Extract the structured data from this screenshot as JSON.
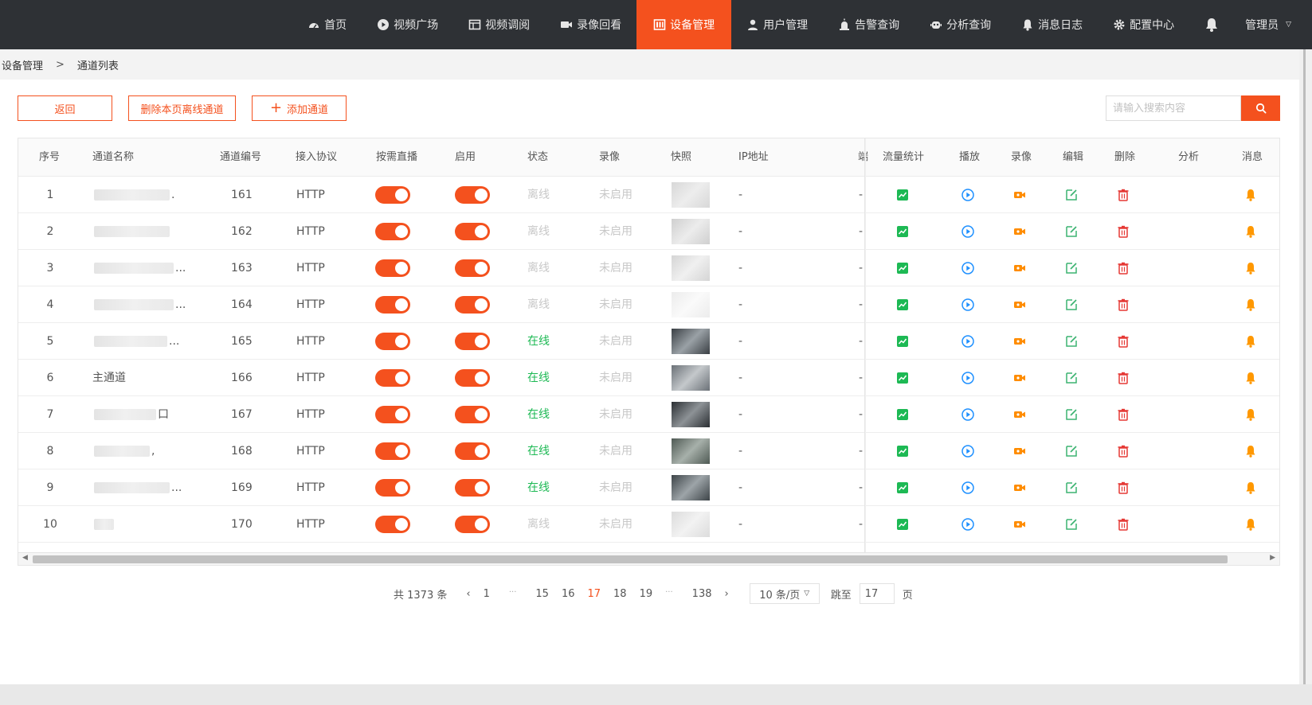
{
  "nav": {
    "items": [
      {
        "label": "首页",
        "icon": "dashboard-icon"
      },
      {
        "label": "视频广场",
        "icon": "play-circle-icon"
      },
      {
        "label": "视频调阅",
        "icon": "grid-icon"
      },
      {
        "label": "录像回看",
        "icon": "video-camera-icon"
      },
      {
        "label": "设备管理",
        "icon": "device-icon",
        "active": true
      },
      {
        "label": "用户管理",
        "icon": "user-icon"
      },
      {
        "label": "告警查询",
        "icon": "alarm-icon"
      },
      {
        "label": "分析查询",
        "icon": "robot-icon"
      },
      {
        "label": "消息日志",
        "icon": "bell-icon"
      },
      {
        "label": "配置中心",
        "icon": "gear-icon"
      }
    ],
    "user": "管理员"
  },
  "breadcrumb": {
    "root": "设备管理",
    "sep": ">",
    "current": "通道列表"
  },
  "toolbar": {
    "back": "返回",
    "delete_offline": "删除本页离线通道",
    "add_channel": "添加通道"
  },
  "search": {
    "placeholder": "请输入搜索内容"
  },
  "table": {
    "headers": {
      "index": "序号",
      "name": "通道名称",
      "code": "通道编号",
      "protocol": "接入协议",
      "ondemand": "按需直播",
      "enabled": "启用",
      "status": "状态",
      "record": "录像",
      "snapshot": "快照",
      "ip": "IP地址",
      "port": "端",
      "traffic": "流量统计",
      "play": "播放",
      "recording": "录像",
      "edit": "编辑",
      "delete": "删除",
      "analysis": "分析",
      "message": "消息"
    },
    "rows": [
      {
        "index": "1",
        "name": "",
        "name_suffix": ".",
        "code": "161",
        "protocol": "HTTP",
        "status": "离线",
        "online": false,
        "record": "未启用",
        "ip": "-",
        "port": "-"
      },
      {
        "index": "2",
        "name": "",
        "name_suffix": "",
        "code": "162",
        "protocol": "HTTP",
        "status": "离线",
        "online": false,
        "record": "未启用",
        "ip": "-",
        "port": "-"
      },
      {
        "index": "3",
        "name": "",
        "name_suffix": "...",
        "code": "163",
        "protocol": "HTTP",
        "status": "离线",
        "online": false,
        "record": "未启用",
        "ip": "-",
        "port": "-"
      },
      {
        "index": "4",
        "name": "",
        "name_suffix": "...",
        "code": "164",
        "protocol": "HTTP",
        "status": "离线",
        "online": false,
        "record": "未启用",
        "ip": "-",
        "port": "-"
      },
      {
        "index": "5",
        "name": "",
        "name_suffix": "...",
        "code": "165",
        "protocol": "HTTP",
        "status": "在线",
        "online": true,
        "record": "未启用",
        "ip": "-",
        "port": "-"
      },
      {
        "index": "6",
        "name": "主通道",
        "name_suffix": "",
        "code": "166",
        "protocol": "HTTP",
        "status": "在线",
        "online": true,
        "record": "未启用",
        "ip": "-",
        "port": "-"
      },
      {
        "index": "7",
        "name": "",
        "name_suffix": "口",
        "code": "167",
        "protocol": "HTTP",
        "status": "在线",
        "online": true,
        "record": "未启用",
        "ip": "-",
        "port": "-"
      },
      {
        "index": "8",
        "name": "",
        "name_suffix": ",",
        "code": "168",
        "protocol": "HTTP",
        "status": "在线",
        "online": true,
        "record": "未启用",
        "ip": "-",
        "port": "-"
      },
      {
        "index": "9",
        "name": "",
        "name_suffix": "...",
        "code": "169",
        "protocol": "HTTP",
        "status": "在线",
        "online": true,
        "record": "未启用",
        "ip": "-",
        "port": "-"
      },
      {
        "index": "10",
        "name": "",
        "name_suffix": "",
        "code": "170",
        "protocol": "HTTP",
        "status": "离线",
        "online": false,
        "record": "未启用",
        "ip": "-",
        "port": "-"
      }
    ]
  },
  "pager": {
    "total": "共 1373 条",
    "pages": [
      "1",
      "···",
      "15",
      "16",
      "17",
      "18",
      "19",
      "···",
      "138"
    ],
    "current": "17",
    "page_size": "10 条/页",
    "jump_label": "跳至",
    "jump_value": "17",
    "page_unit": "页"
  },
  "colors": {
    "accent": "#f4511e",
    "nav_bg": "#2e3135",
    "online": "#1db954",
    "play": "#1e90ff",
    "record": "#ff8c00",
    "edit": "#3cb371",
    "delete": "#e53935",
    "message": "#ff9800"
  }
}
